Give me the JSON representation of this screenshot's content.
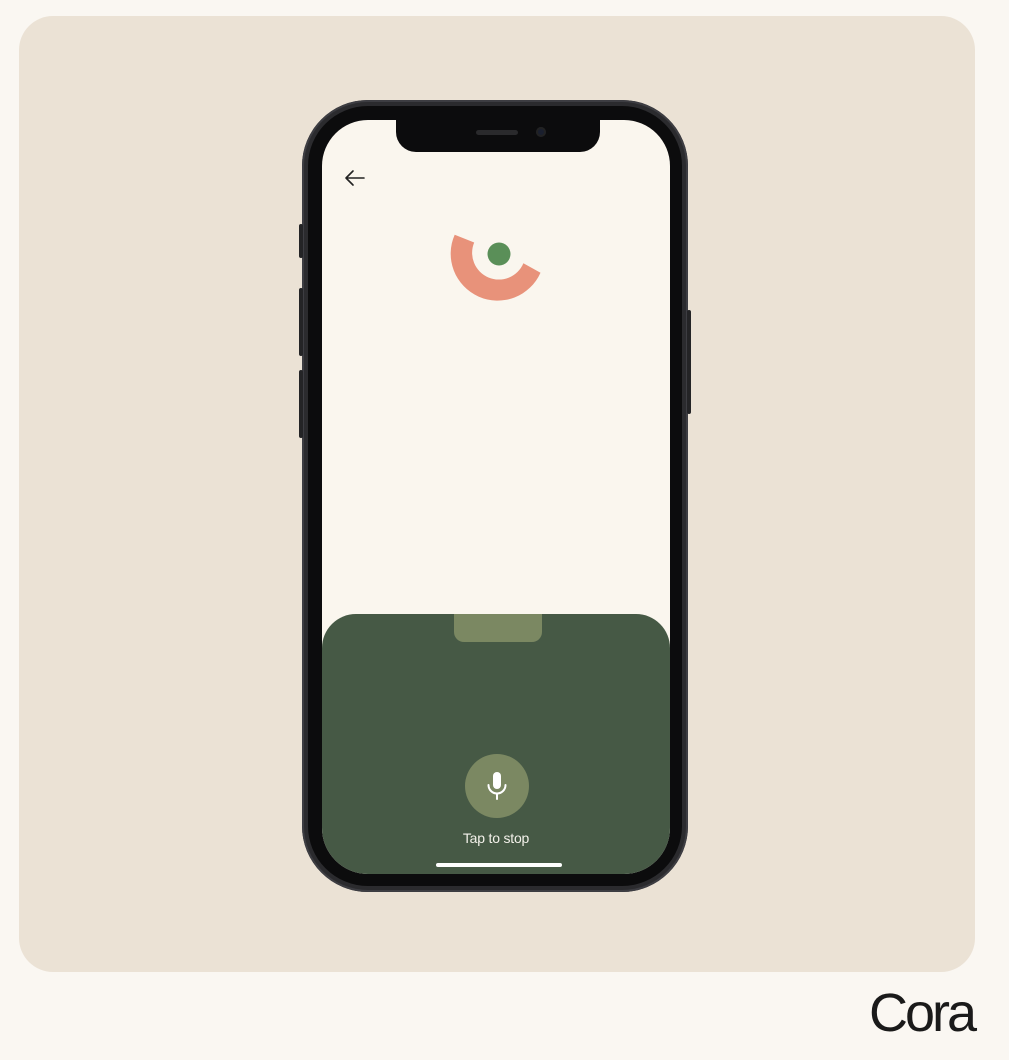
{
  "brand": {
    "name": "Cora"
  },
  "screen": {
    "back_icon": "arrow-left-icon",
    "logo_icon": "cora-logo-mark",
    "mic": {
      "icon": "microphone-icon",
      "label": "Tap to stop"
    }
  },
  "colors": {
    "page_background": "#faf7f2",
    "stage_background": "#ebe2d5",
    "screen_background": "#faf6ee",
    "panel_green": "#465945",
    "accent_olive": "#7b8862",
    "logo_coral": "#e8927a",
    "logo_green": "#5a8f58"
  }
}
